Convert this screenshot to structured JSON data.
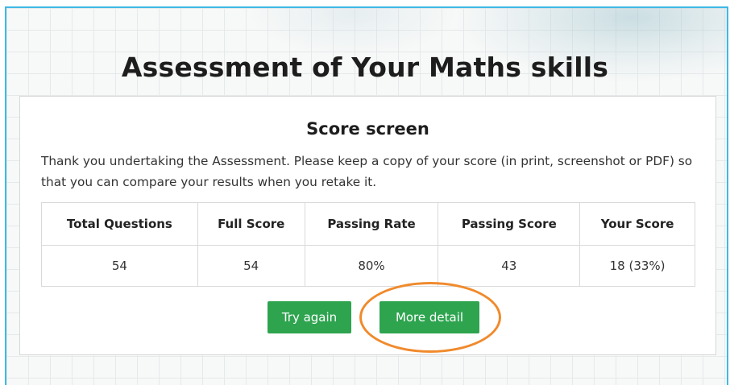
{
  "page": {
    "title": "Assessment of Your Maths skills"
  },
  "score_card": {
    "title": "Score screen",
    "intro": "Thank you undertaking the Assessment. Please keep a copy of your score (in print, screenshot or PDF) so that you can compare your results when you retake it.",
    "table": {
      "headers": [
        "Total Questions",
        "Full Score",
        "Passing Rate",
        "Passing Score",
        "Your Score"
      ],
      "values": [
        "54",
        "54",
        "80%",
        "43",
        "18 (33%)"
      ]
    },
    "buttons": {
      "try_again": "Try again",
      "more_detail": "More detail"
    }
  },
  "colors": {
    "frame_border": "#3fb8e6",
    "button": "#2ea44f",
    "highlight_ring": "#f08a2c"
  }
}
